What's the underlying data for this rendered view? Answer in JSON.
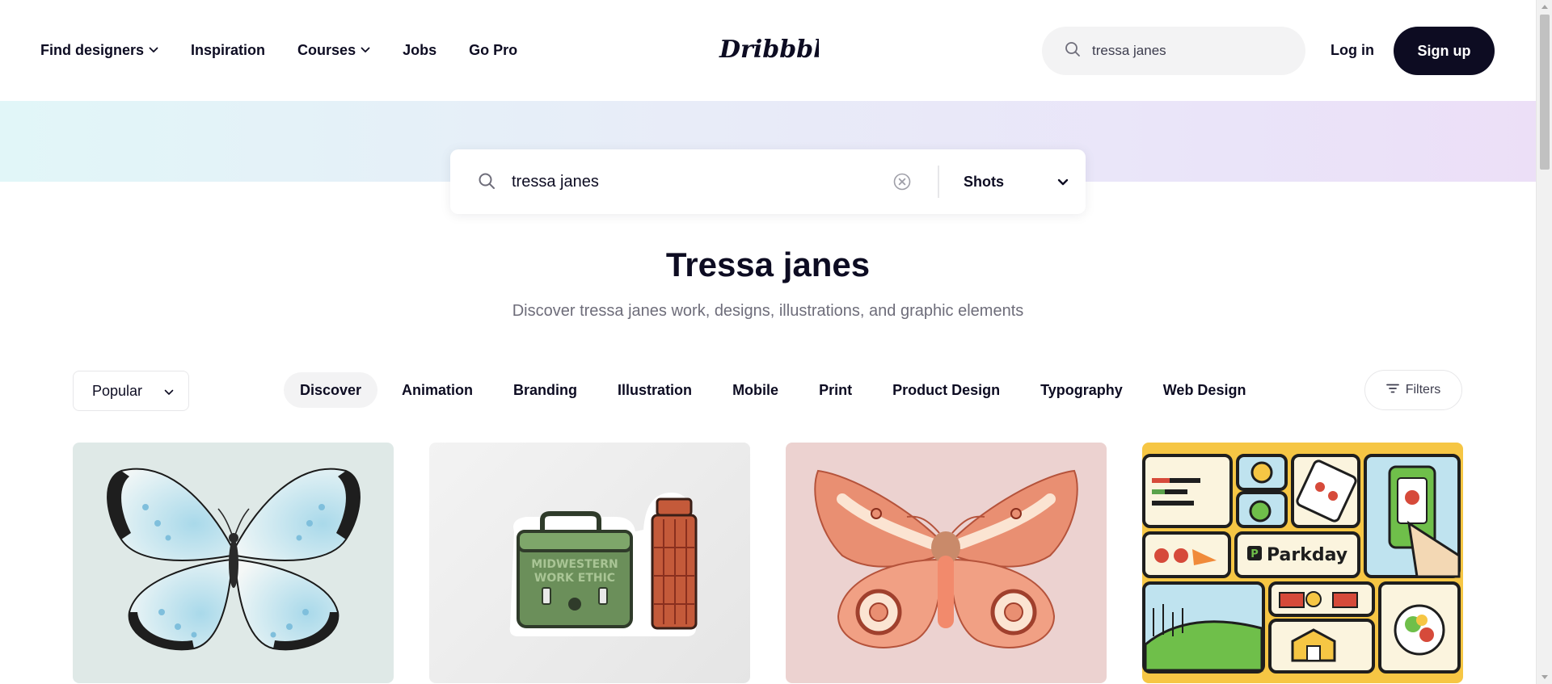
{
  "header": {
    "nav": [
      {
        "label": "Find designers",
        "has_dropdown": true
      },
      {
        "label": "Inspiration",
        "has_dropdown": false
      },
      {
        "label": "Courses",
        "has_dropdown": true
      },
      {
        "label": "Jobs",
        "has_dropdown": false
      },
      {
        "label": "Go Pro",
        "has_dropdown": false
      }
    ],
    "logo_text": "Dribbble",
    "search_value": "tressa janes",
    "login_label": "Log in",
    "signup_label": "Sign up"
  },
  "hero": {
    "search_value": "tressa janes",
    "type_select": "Shots"
  },
  "results": {
    "title": "Tressa janes",
    "subtitle": "Discover tressa janes work, designs, illustrations, and graphic elements"
  },
  "filters": {
    "sort": "Popular",
    "categories": [
      "Discover",
      "Animation",
      "Branding",
      "Illustration",
      "Mobile",
      "Print",
      "Product Design",
      "Typography",
      "Web Design"
    ],
    "active_category": "Discover",
    "filters_label": "Filters"
  },
  "shots": [
    {
      "subject": "butterfly illustration",
      "bg": "#dfe9e7"
    },
    {
      "subject": "lunch box and thermos sticker",
      "bg": "#ececec",
      "texts": [
        "MIDWESTERN",
        "WORK ETHIC"
      ]
    },
    {
      "subject": "moth illustration",
      "bg": "#ecd3d1"
    },
    {
      "subject": "Parkday illustration grid",
      "bg": "#f6c644",
      "texts": [
        "Parkday"
      ]
    }
  ],
  "colors": {
    "primary": "#0d0c22",
    "muted_text": "#6e6d7a",
    "pill_bg": "#f3f3f4"
  }
}
